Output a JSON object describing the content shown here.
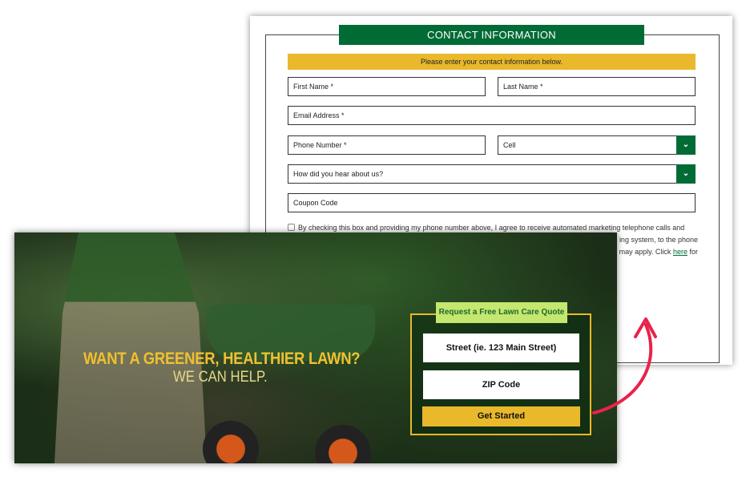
{
  "contact_form": {
    "title": "CONTACT INFORMATION",
    "instruction": "Please enter your contact information below.",
    "first_name_placeholder": "First Name *",
    "last_name_placeholder": "Last Name *",
    "email_placeholder": "Email Address *",
    "phone_placeholder": "Phone Number *",
    "phone_type_selected": "Cell",
    "referral_selected": "How did you hear about us?",
    "coupon_placeholder": "Coupon Code",
    "consent_line1": "By checking this box and providing my phone number above, I agree to receive automated marketing telephone calls and",
    "consent_line2": "ing system, to the phone",
    "consent_line3": "may apply. Click",
    "consent_link": "here",
    "consent_line3_end": "for"
  },
  "hero": {
    "headline": "WANT A GREENER, HEALTHIER LAWN?",
    "subheadline": "WE CAN HELP."
  },
  "quote_form": {
    "tag": "Request a Free Lawn Care Quote",
    "street_placeholder": "Street (ie. 123 Main Street)",
    "zip_placeholder": "ZIP Code",
    "submit_label": "Get Started"
  },
  "colors": {
    "brand_green": "#006b35",
    "accent_yellow": "#e9b82b",
    "tag_green": "#c5e66f",
    "arrow_red": "#e8234a"
  }
}
